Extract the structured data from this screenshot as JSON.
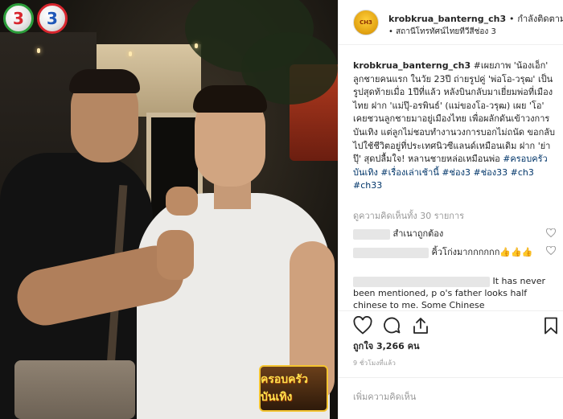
{
  "photo": {
    "channel_logo_text": "3",
    "show_logo_text": "ครอบครัวบันเทิง"
  },
  "header": {
    "username": "krobkrua_banterng_ch3",
    "separator": "•",
    "follow_label": "กำลังติดตาม",
    "location": "• สถานีโทรทัศน์ไทยทีวีสีช่อง 3"
  },
  "caption": {
    "username": "krobkrua_banterng_ch3",
    "text": "#เผยภาพ 'น้องเอ็ก' ลูกชายคนแรก ในวัย 23ปี ถ่ายรูปคู่ 'พ่อโอ-วรุฒ' เป็นรูปสุดท้ายเมื่อ 1ปีที่แล้ว หลังบินกลับมาเยี่ยมพ่อที่เมืองไทย ฝาก 'แม่ปุ๊-อรพินธ์' (แม่ของโอ-วรุฒ) เผย 'โอ' เคยชวนลูกชายมาอยู่เมืองไทย เพื่อผลักดันเข้าวงการบันเทิง แต่ลูกไม่ชอบทำงานวงการบอกไม่ถนัด ขอกลับไปใช้ชีวิตอยู่ที่ประเทศนิวซีแลนด์เหมือนเดิม ฝาก 'ย่าปุ๊' สุดปลื้มใจ! หลานชายหล่อเหมือนพ่อ",
    "hashtags": "#ครอบครัวบันเทิง #เรื่องเล่าเช้านี้ #ช่อง3 #ช่อง33 #ch3 #ch33"
  },
  "view_all_comments": "ดูความคิดเห็นทั้ง 30 รายการ",
  "comments": [
    {
      "text": "สำเนาถูกต้อง"
    },
    {
      "text": "คิ้วโก่งมากกกกกก👍👍👍"
    },
    {
      "text": "It has never been mentioned, p o's father looks half chinese to me. Some Chinese"
    }
  ],
  "likes": "ถูกใจ 3,266 คน",
  "timestamp": "9 ชั่วโมงที่แล้ว",
  "add_comment_placeholder": "เพิ่มความคิดเห็น",
  "icons": [
    "heart-icon",
    "comment-icon",
    "share-icon",
    "bookmark-icon"
  ],
  "colors": {
    "hashtag": "#003569",
    "muted": "#999999",
    "text": "#262626"
  }
}
